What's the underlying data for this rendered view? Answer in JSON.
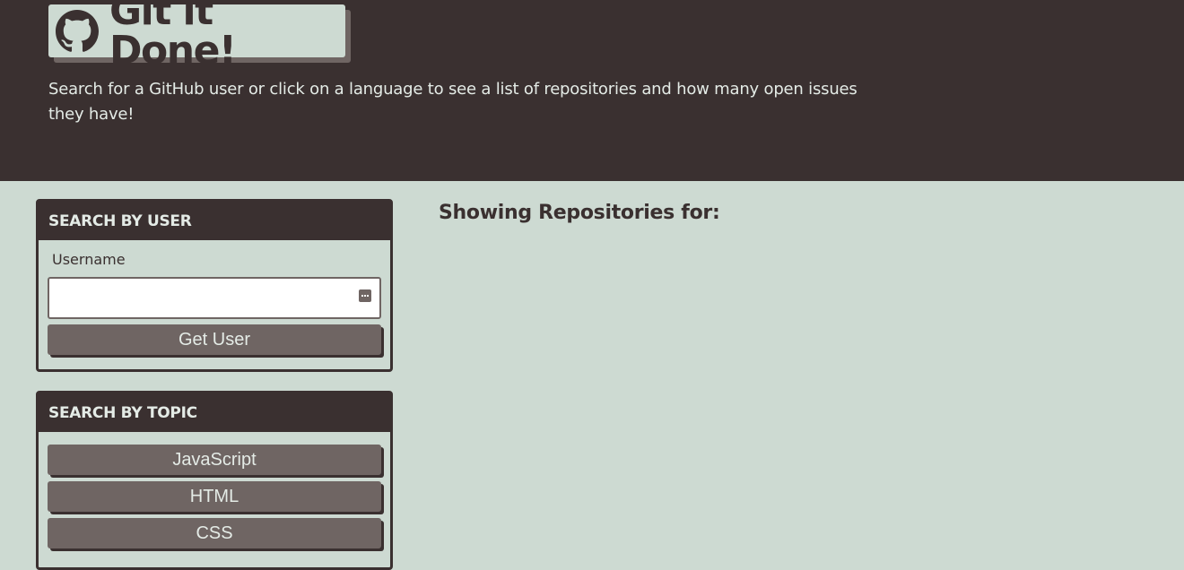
{
  "header": {
    "logo_icon": "github-octocat-icon",
    "title": "Git it Done!",
    "subtitle": "Search for a GitHub user or click on a language to see a list of repositories and how many open issues they have!"
  },
  "search_user": {
    "heading": "SEARCH BY USER",
    "username_label": "Username",
    "username_value": "",
    "input_icon": "password-manager-icon",
    "button_label": "Get User"
  },
  "search_topic": {
    "heading": "SEARCH BY TOPIC",
    "topics": [
      "JavaScript",
      "HTML",
      "CSS"
    ]
  },
  "results": {
    "title": "Showing Repositories for:",
    "search_term": ""
  },
  "colors": {
    "header_bg": "#3a3030",
    "page_bg": "#cddad2",
    "button_bg": "#6f6563",
    "text_light": "#e4ebe6"
  }
}
